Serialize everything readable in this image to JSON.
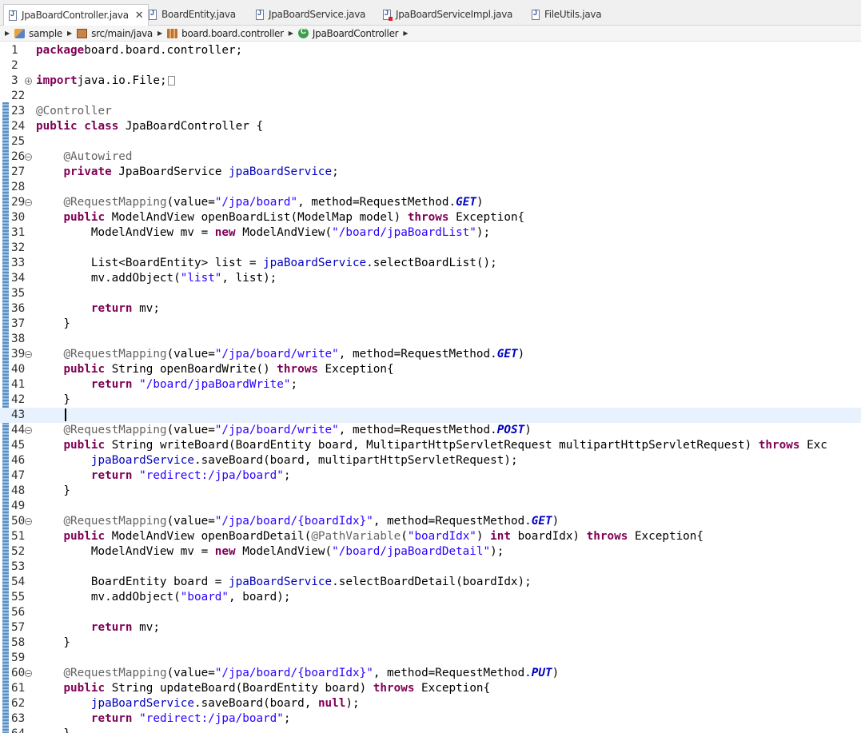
{
  "tabs": [
    {
      "label": "JpaBoardController.java",
      "active": true,
      "icon": "java-file-icon"
    },
    {
      "label": "BoardEntity.java",
      "active": false,
      "icon": "java-file-icon"
    },
    {
      "label": "JpaBoardService.java",
      "active": false,
      "icon": "java-file-icon"
    },
    {
      "label": "JpaBoardServiceImpl.java",
      "active": false,
      "icon": "java-file-error-icon"
    },
    {
      "label": "FileUtils.java",
      "active": false,
      "icon": "java-file-icon"
    }
  ],
  "breadcrumb": [
    {
      "label": "sample",
      "icon": "project-icon"
    },
    {
      "label": "src/main/java",
      "icon": "source-folder-icon"
    },
    {
      "label": "board.board.controller",
      "icon": "package-icon"
    },
    {
      "label": "JpaBoardController",
      "icon": "class-icon"
    }
  ],
  "editor": {
    "current_line": "43",
    "lines": [
      {
        "n": "1",
        "tokens": [
          [
            "kw",
            "package"
          ],
          [
            "",
            "board.board.controller;"
          ]
        ]
      },
      {
        "n": "2",
        "tokens": []
      },
      {
        "n": "3",
        "fold": "+",
        "tokens": [
          [
            "kw",
            "import"
          ],
          [
            "",
            "java.io.File;"
          ]
        ]
      },
      {
        "n": "22",
        "tokens": []
      },
      {
        "n": "23",
        "tokens": [
          [
            "ann",
            "@Controller"
          ]
        ]
      },
      {
        "n": "24",
        "tokens": [
          [
            "kw",
            "public"
          ],
          [
            "",
            " "
          ],
          [
            "kw",
            "class"
          ],
          [
            "",
            " JpaBoardController {"
          ]
        ]
      },
      {
        "n": "25",
        "tokens": []
      },
      {
        "n": "26",
        "fold": "-",
        "tokens": [
          [
            "",
            "    "
          ],
          [
            "ann",
            "@Autowired"
          ]
        ]
      },
      {
        "n": "27",
        "tokens": [
          [
            "",
            "    "
          ],
          [
            "kw",
            "private"
          ],
          [
            "",
            " JpaBoardService "
          ],
          [
            "fld",
            "jpaBoardService"
          ],
          [
            "",
            ";"
          ]
        ]
      },
      {
        "n": "28",
        "tokens": []
      },
      {
        "n": "29",
        "fold": "-",
        "tokens": [
          [
            "",
            "    "
          ],
          [
            "ann",
            "@RequestMapping"
          ],
          [
            "",
            "(value="
          ],
          [
            "str",
            "\"/jpa/board\""
          ],
          [
            "",
            ", method=RequestMethod."
          ],
          [
            "enm",
            "GET"
          ],
          [
            "",
            ")"
          ]
        ]
      },
      {
        "n": "30",
        "tokens": [
          [
            "",
            "    "
          ],
          [
            "kw",
            "public"
          ],
          [
            "",
            " ModelAndView openBoardList(ModelMap model) "
          ],
          [
            "kw",
            "throws"
          ],
          [
            "",
            " Exception{"
          ]
        ]
      },
      {
        "n": "31",
        "tokens": [
          [
            "",
            "        ModelAndView mv = "
          ],
          [
            "kw",
            "new"
          ],
          [
            "",
            " ModelAndView("
          ],
          [
            "str",
            "\"/board/jpaBoardList\""
          ],
          [
            "",
            ");"
          ]
        ]
      },
      {
        "n": "32",
        "tokens": []
      },
      {
        "n": "33",
        "tokens": [
          [
            "",
            "        List<BoardEntity> list = "
          ],
          [
            "fld",
            "jpaBoardService"
          ],
          [
            "",
            ".selectBoardList();"
          ]
        ]
      },
      {
        "n": "34",
        "tokens": [
          [
            "",
            "        mv.addObject("
          ],
          [
            "str",
            "\"list\""
          ],
          [
            "",
            ", list);"
          ]
        ]
      },
      {
        "n": "35",
        "tokens": []
      },
      {
        "n": "36",
        "tokens": [
          [
            "",
            "        "
          ],
          [
            "kw",
            "return"
          ],
          [
            "",
            " mv;"
          ]
        ]
      },
      {
        "n": "37",
        "tokens": [
          [
            "",
            "    }"
          ]
        ]
      },
      {
        "n": "38",
        "tokens": []
      },
      {
        "n": "39",
        "fold": "-",
        "tokens": [
          [
            "",
            "    "
          ],
          [
            "ann",
            "@RequestMapping"
          ],
          [
            "",
            "(value="
          ],
          [
            "str",
            "\"/jpa/board/write\""
          ],
          [
            "",
            ", method=RequestMethod."
          ],
          [
            "enm",
            "GET"
          ],
          [
            "",
            ")"
          ]
        ]
      },
      {
        "n": "40",
        "tokens": [
          [
            "",
            "    "
          ],
          [
            "kw",
            "public"
          ],
          [
            "",
            " String openBoardWrite() "
          ],
          [
            "kw",
            "throws"
          ],
          [
            "",
            " Exception{"
          ]
        ]
      },
      {
        "n": "41",
        "tokens": [
          [
            "",
            "        "
          ],
          [
            "kw",
            "return"
          ],
          [
            "",
            " "
          ],
          [
            "str",
            "\"/board/jpaBoardWrite\""
          ],
          [
            "",
            ";"
          ]
        ]
      },
      {
        "n": "42",
        "tokens": [
          [
            "",
            "    }"
          ]
        ]
      },
      {
        "n": "43",
        "tokens": []
      },
      {
        "n": "44",
        "fold": "-",
        "tokens": [
          [
            "",
            "    "
          ],
          [
            "ann",
            "@RequestMapping"
          ],
          [
            "",
            "(value="
          ],
          [
            "str",
            "\"/jpa/board/write\""
          ],
          [
            "",
            ", method=RequestMethod."
          ],
          [
            "enm",
            "POST"
          ],
          [
            "",
            ")"
          ]
        ]
      },
      {
        "n": "45",
        "tokens": [
          [
            "",
            "    "
          ],
          [
            "kw",
            "public"
          ],
          [
            "",
            " String writeBoard(BoardEntity board, MultipartHttpServletRequest multipartHttpServletRequest) "
          ],
          [
            "kw",
            "throws"
          ],
          [
            "",
            " Exc"
          ]
        ]
      },
      {
        "n": "46",
        "tokens": [
          [
            "",
            "        "
          ],
          [
            "fld",
            "jpaBoardService"
          ],
          [
            "",
            ".saveBoard(board, multipartHttpServletRequest);"
          ]
        ]
      },
      {
        "n": "47",
        "tokens": [
          [
            "",
            "        "
          ],
          [
            "kw",
            "return"
          ],
          [
            "",
            " "
          ],
          [
            "str",
            "\"redirect:/jpa/board\""
          ],
          [
            "",
            ";"
          ]
        ]
      },
      {
        "n": "48",
        "tokens": [
          [
            "",
            "    }"
          ]
        ]
      },
      {
        "n": "49",
        "tokens": []
      },
      {
        "n": "50",
        "fold": "-",
        "tokens": [
          [
            "",
            "    "
          ],
          [
            "ann",
            "@RequestMapping"
          ],
          [
            "",
            "(value="
          ],
          [
            "str",
            "\"/jpa/board/{boardIdx}\""
          ],
          [
            "",
            ", method=RequestMethod."
          ],
          [
            "enm",
            "GET"
          ],
          [
            "",
            ")"
          ]
        ]
      },
      {
        "n": "51",
        "tokens": [
          [
            "",
            "    "
          ],
          [
            "kw",
            "public"
          ],
          [
            "",
            " ModelAndView openBoardDetail("
          ],
          [
            "ann",
            "@PathVariable"
          ],
          [
            "",
            "("
          ],
          [
            "str",
            "\"boardIdx\""
          ],
          [
            "",
            ") "
          ],
          [
            "kw",
            "int"
          ],
          [
            "",
            " boardIdx) "
          ],
          [
            "kw",
            "throws"
          ],
          [
            "",
            " Exception{"
          ]
        ]
      },
      {
        "n": "52",
        "tokens": [
          [
            "",
            "        ModelAndView mv = "
          ],
          [
            "kw",
            "new"
          ],
          [
            "",
            " ModelAndView("
          ],
          [
            "str",
            "\"/board/jpaBoardDetail\""
          ],
          [
            "",
            ");"
          ]
        ]
      },
      {
        "n": "53",
        "tokens": []
      },
      {
        "n": "54",
        "tokens": [
          [
            "",
            "        BoardEntity board = "
          ],
          [
            "fld",
            "jpaBoardService"
          ],
          [
            "",
            ".selectBoardDetail(boardIdx);"
          ]
        ]
      },
      {
        "n": "55",
        "tokens": [
          [
            "",
            "        mv.addObject("
          ],
          [
            "str",
            "\"board\""
          ],
          [
            "",
            ", board);"
          ]
        ]
      },
      {
        "n": "56",
        "tokens": []
      },
      {
        "n": "57",
        "tokens": [
          [
            "",
            "        "
          ],
          [
            "kw",
            "return"
          ],
          [
            "",
            " mv;"
          ]
        ]
      },
      {
        "n": "58",
        "tokens": [
          [
            "",
            "    }"
          ]
        ]
      },
      {
        "n": "59",
        "tokens": []
      },
      {
        "n": "60",
        "fold": "-",
        "tokens": [
          [
            "",
            "    "
          ],
          [
            "ann",
            "@RequestMapping"
          ],
          [
            "",
            "(value="
          ],
          [
            "str",
            "\"/jpa/board/{boardIdx}\""
          ],
          [
            "",
            ", method=RequestMethod."
          ],
          [
            "enm",
            "PUT"
          ],
          [
            "",
            ")"
          ]
        ]
      },
      {
        "n": "61",
        "tokens": [
          [
            "",
            "    "
          ],
          [
            "kw",
            "public"
          ],
          [
            "",
            " String updateBoard(BoardEntity board) "
          ],
          [
            "kw",
            "throws"
          ],
          [
            "",
            " Exception{"
          ]
        ]
      },
      {
        "n": "62",
        "tokens": [
          [
            "",
            "        "
          ],
          [
            "fld",
            "jpaBoardService"
          ],
          [
            "",
            ".saveBoard(board, "
          ],
          [
            "kw",
            "null"
          ],
          [
            "",
            ");"
          ]
        ]
      },
      {
        "n": "63",
        "tokens": [
          [
            "",
            "        "
          ],
          [
            "kw",
            "return"
          ],
          [
            "",
            " "
          ],
          [
            "str",
            "\"redirect:/jpa/board\""
          ],
          [
            "",
            ";"
          ]
        ]
      },
      {
        "n": "64",
        "tokens": [
          [
            "",
            "    }"
          ]
        ]
      }
    ]
  }
}
